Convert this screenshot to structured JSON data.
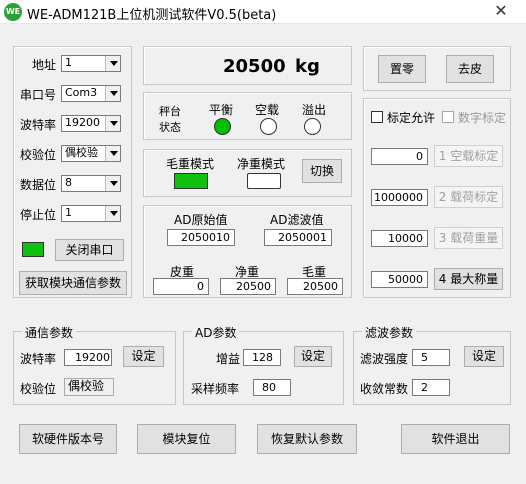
{
  "window": {
    "icon_text": "WE",
    "title": "WE-ADM121B上位机测试软件V0.5(beta)",
    "close_symbol": "✕"
  },
  "serial": {
    "address_label": "地址",
    "address_value": "1",
    "port_label": "串口号",
    "port_value": "Com3",
    "baud_label": "波特率",
    "baud_value": "19200",
    "parity_label": "校验位",
    "parity_value": "偶校验",
    "databits_label": "数据位",
    "databits_value": "8",
    "stopbits_label": "停止位",
    "stopbits_value": "1",
    "close_port_button": "关闭串口",
    "get_params_button": "获取模块通信参数",
    "port_indicator_color": "#10c010"
  },
  "weight_display": {
    "value": "20500",
    "unit": "kg"
  },
  "status": {
    "label_line1": "秤台",
    "label_line2": "状态",
    "balance_label": "平衡",
    "empty_label": "空载",
    "overflow_label": "溢出",
    "balance_on": true,
    "empty_on": false,
    "overflow_on": false
  },
  "mode": {
    "gross_label": "毛重模式",
    "net_label": "净重模式",
    "switch_button": "切换",
    "gross_on": true,
    "net_on": false
  },
  "ad": {
    "raw_label": "AD原始值",
    "raw_value": "2050010",
    "filtered_label": "AD滤波值",
    "filtered_value": "2050001",
    "tare_label": "皮重",
    "tare_value": "0",
    "net_label": "净重",
    "net_value": "20500",
    "gross_label": "毛重",
    "gross_value": "20500"
  },
  "actions": {
    "zero_button": "置零",
    "tare_button": "去皮"
  },
  "calibration": {
    "allow_label": "标定允许",
    "digital_label": "数字标定",
    "rows": [
      {
        "value": "0",
        "button": "1 空载标定",
        "enabled": false
      },
      {
        "value": "1000000",
        "button": "2 载荷标定",
        "enabled": false
      },
      {
        "value": "10000",
        "button": "3 载荷重量",
        "enabled": false
      },
      {
        "value": "50000",
        "button": "4 最大称量",
        "enabled": true
      }
    ]
  },
  "comm_params": {
    "title": "通信参数",
    "baud_label": "波特率",
    "baud_value": "19200",
    "set_button": "设定",
    "parity_label": "校验位",
    "parity_value": "偶校验"
  },
  "ad_params": {
    "title": "AD参数",
    "gain_label": "增益",
    "gain_value": "128",
    "set_button": "设定",
    "rate_label": "采样频率",
    "rate_value": "80"
  },
  "filter_params": {
    "title": "滤波参数",
    "strength_label": "滤波强度",
    "strength_value": "5",
    "set_button": "设定",
    "converge_label": "收敛常数",
    "converge_value": "2"
  },
  "bottom": {
    "version_button": "软硬件版本号",
    "reset_button": "模块复位",
    "defaults_button": "恢复默认参数",
    "exit_button": "软件退出"
  }
}
